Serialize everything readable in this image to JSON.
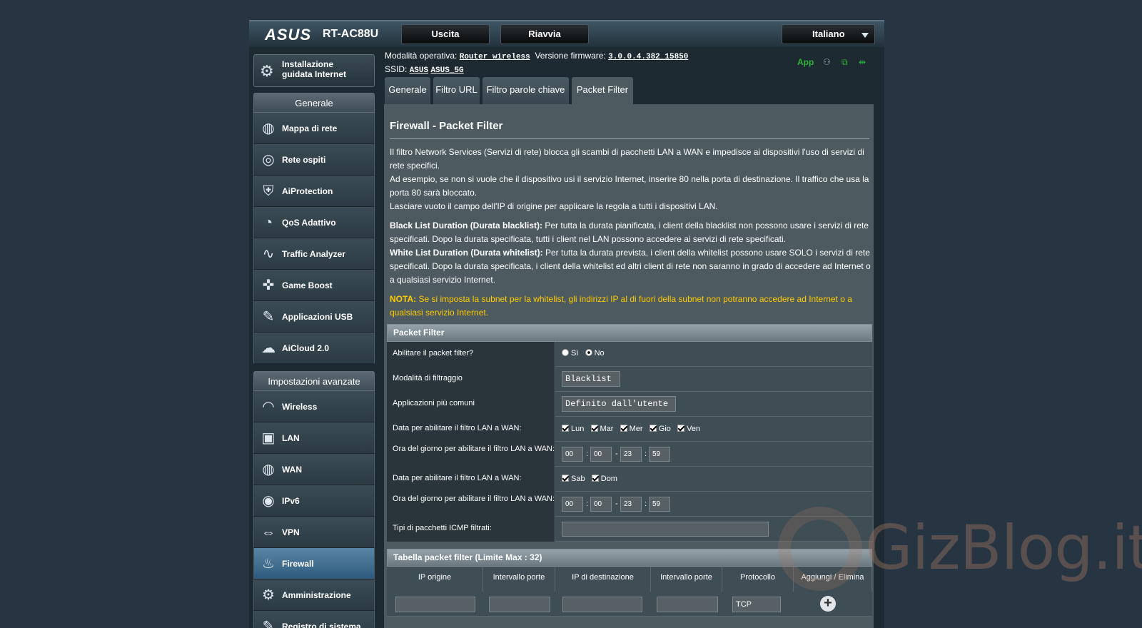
{
  "header": {
    "logo": "ASUS",
    "model": "RT-AC88U",
    "logout_label": "Uscita",
    "reboot_label": "Riavvia",
    "language": "Italiano"
  },
  "info": {
    "mode_label": "Modalità operativa:",
    "mode_value": "Router wireless",
    "firmware_label": "Versione firmware:",
    "firmware_value": "3.0.0.4.382_15850",
    "ssid_label": "SSID:",
    "ssid_1": "ASUS",
    "ssid_2": "ASUS_5G",
    "app_label": "App"
  },
  "sidebar": {
    "qis_label_1": "Installazione",
    "qis_label_2": "guidata Internet",
    "general_header": "Generale",
    "general_items": [
      {
        "label": "Mappa di rete",
        "icon": "network-map-icon"
      },
      {
        "label": "Rete ospiti",
        "icon": "guest-network-icon"
      },
      {
        "label": "AiProtection",
        "icon": "shield-icon"
      },
      {
        "label": "QoS Adattivo",
        "icon": "gauge-icon"
      },
      {
        "label": "Traffic Analyzer",
        "icon": "analyzer-icon"
      },
      {
        "label": "Game Boost",
        "icon": "gamepad-icon"
      },
      {
        "label": "Applicazioni USB",
        "icon": "usb-apps-icon"
      },
      {
        "label": "AiCloud 2.0",
        "icon": "cloud-icon"
      }
    ],
    "advanced_header": "Impostazioni avanzate",
    "advanced_items": [
      {
        "label": "Wireless",
        "icon": "wireless-icon"
      },
      {
        "label": "LAN",
        "icon": "lan-icon"
      },
      {
        "label": "WAN",
        "icon": "wan-globe-icon"
      },
      {
        "label": "IPv6",
        "icon": "ipv6-icon"
      },
      {
        "label": "VPN",
        "icon": "vpn-icon"
      },
      {
        "label": "Firewall",
        "icon": "firewall-flame-icon"
      },
      {
        "label": "Amministrazione",
        "icon": "gear-admin-icon"
      },
      {
        "label": "Registro di sistema",
        "icon": "log-icon"
      }
    ]
  },
  "tabs": [
    "Generale",
    "Filtro URL",
    "Filtro parole chiave",
    "Packet Filter"
  ],
  "content": {
    "title": "Firewall - Packet Filter",
    "p1": "Il filtro Network Services (Servizi di rete) blocca gli scambi di pacchetti LAN a WAN e impedisce ai dispositivi l'uso di servizi di rete specifici.",
    "p2": "Ad esempio, se non si vuole che il dispositivo usi il servizio Internet, inserire 80 nella porta di destinazione. Il traffico che usa la porta 80 sarà bloccato.",
    "p3": "Lasciare vuoto il campo dell'IP di origine per applicare la regola a tutti i dispositivi LAN.",
    "black_title": "Black List Duration (Durata blacklist):",
    "black_text": " Per tutta la durata pianificata, i client della blacklist non possono usare i servizi di rete specificati. Dopo la durata specificata, tutti i client nel LAN possono accedere ai servizi di rete specificati.",
    "white_title": "White List Duration (Durata whitelist):",
    "white_text": " Per tutta la durata prevista, i client della whitelist possono usare SOLO i servizi di rete specificati. Dopo la durata specificata, i client della whitelist ed altri client di rete non saranno in grado di accedere ad Internet o a qualsiasi servizio Internet.",
    "nota_title": "NOTA:",
    "nota_text": " Se si imposta la subnet per la whitelist, gli indirizzi IP al di fuori della subnet non potranno accedere ad Internet o a qualsiasi servizio Internet."
  },
  "packet_filter": {
    "header": "Packet Filter",
    "enable_label": "Abilitare il packet filter?",
    "yes": "Sì",
    "no": "No",
    "mode_label": "Modalità di filtraggio",
    "mode_value": "Blacklist",
    "apps_label": "Applicazioni più comuni",
    "apps_value": "Definito dall'utente",
    "date1_label": "Data per abilitare il filtro LAN a WAN:",
    "weekdays": [
      "Lun",
      "Mar",
      "Mer",
      "Gio",
      "Ven"
    ],
    "time1_label": "Ora del giorno per abilitare il filtro LAN a WAN:",
    "time1": [
      "00",
      "00",
      "23",
      "59"
    ],
    "date2_label": "Data per abilitare il filtro LAN a WAN:",
    "weekend": [
      "Sab",
      "Dom"
    ],
    "time2_label": "Ora del giorno per abilitare il filtro LAN a WAN:",
    "time2": [
      "00",
      "00",
      "23",
      "59"
    ],
    "icmp_label": "Tipi di pacchetti ICMP filtrati:"
  },
  "filter_table": {
    "header": "Tabella packet filter (Limite Max : 32)",
    "columns": [
      "IP origine",
      "Intervallo porte",
      "IP di destinazione",
      "Intervallo porte",
      "Protocollo",
      "Aggiungi / Elimina"
    ],
    "protocol_value": "TCP"
  },
  "watermark": "GizBlog.it"
}
